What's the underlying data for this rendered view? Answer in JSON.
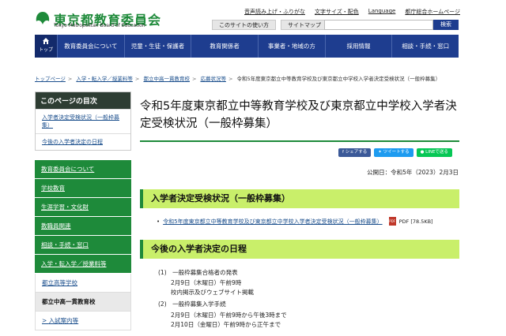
{
  "header": {
    "logo_title": "東京都教育委員会",
    "logo_sub": "Tokyo Metropolitan Board of Education",
    "util_links": [
      "音声読み上げ・ふりがな",
      "文字サイズ・配色",
      "Language",
      "都庁総合ホームページ"
    ],
    "usage_button": "このサイトの使い方",
    "sitemap_button": "サイトマップ",
    "search_button": "検索"
  },
  "gnav": {
    "home_label": "トップ",
    "items": [
      "教育委員会について",
      "児童・生徒・保護者",
      "教育関係者",
      "事業者・地域の方",
      "採用情報",
      "相談・手続・窓口"
    ]
  },
  "breadcrumb": {
    "items": [
      "トップページ",
      "入学・転入学／授業料等",
      "都立中高一貫教育校",
      "応募状況等"
    ],
    "current": "令和5年度東京都立中等教育学校及び東京都立中学校入学者決定受検状況（一般枠募集）"
  },
  "toc": {
    "title": "このページの目次",
    "items": [
      "入学者決定受検状況（一般枠募集）",
      "今後の入学者決定の日程"
    ]
  },
  "sidenav": {
    "items": [
      "教育委員会について",
      "学校教育",
      "生涯学習・文化財",
      "教職員関連",
      "相談・手続・窓口",
      "入学・転入学／授業料等"
    ],
    "sub_item": "都立高等学校",
    "active_item": "都立中高一貫教育校",
    "sub_sub_item": "入試案内等"
  },
  "main": {
    "title": "令和5年度東京都立中等教育学校及び東京都立中学校入学者決定受検状況（一般枠募集）",
    "share": {
      "facebook": "シェアする",
      "twitter": "ツイートする",
      "line": "LINEで送る"
    },
    "pubdate": "公開日：令和5年（2023）2月3日",
    "section1": "入学者決定受検状況（一般枠募集）",
    "doc_link": "令和5年度東京都立中等教育学校及び東京都立中学校入学者決定受検状況（一般枠募集）",
    "doc_type": "PDF",
    "doc_size": "PDF [78.5KB]",
    "section2": "今後の入学者決定の日程",
    "schedule": [
      {
        "label": "(1)　一般枠募集合格者の発表",
        "lines": [
          "2月9日（木曜日）午前9時",
          "校内掲示及びウェブサイト掲載"
        ]
      },
      {
        "label": "(2)　一般枠募集入学手続",
        "lines": [
          "2月9日（木曜日）午前9時から午後3時まで",
          "2月10日（金曜日）午前9時から正午まで"
        ]
      }
    ]
  },
  "colors": {
    "nav_blue": "#1e3d8f",
    "brand_green": "#1e8a3a",
    "section_lime": "#c9ef6a"
  }
}
